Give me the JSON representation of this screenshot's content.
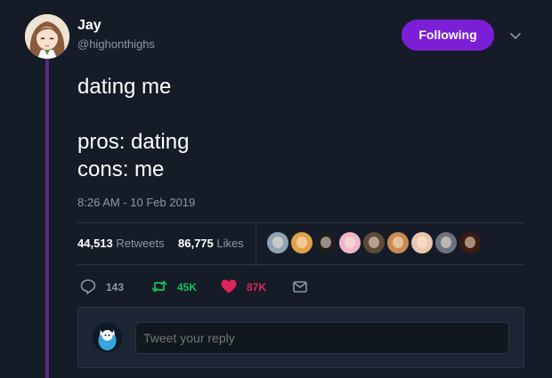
{
  "user": {
    "name": "Jay",
    "handle": "@highonthighs",
    "follow_label": "Following"
  },
  "tweet": {
    "lines": [
      "dating me",
      "",
      "pros: dating",
      "cons: me"
    ],
    "timestamp": "8:26 AM - 10 Feb 2019"
  },
  "stats": {
    "retweets_count": "44,513",
    "retweets_label": "Retweets",
    "likes_count": "86,775",
    "likes_label": "Likes"
  },
  "likers": [
    {
      "name": "liker-avatar-1",
      "color": "#8fa3b3"
    },
    {
      "name": "liker-avatar-2",
      "color": "#e0a24a"
    },
    {
      "name": "liker-avatar-3",
      "color": "#1d1d1d"
    },
    {
      "name": "liker-avatar-4",
      "color": "#f0b6c8"
    },
    {
      "name": "liker-avatar-5",
      "color": "#5b4a35"
    },
    {
      "name": "liker-avatar-6",
      "color": "#c98b52"
    },
    {
      "name": "liker-avatar-7",
      "color": "#e8c7b0"
    },
    {
      "name": "liker-avatar-8",
      "color": "#6c7380"
    },
    {
      "name": "liker-avatar-9",
      "color": "#3a1d12"
    }
  ],
  "actions": {
    "reply_count": "143",
    "retweet_count": "45K",
    "like_count": "87K"
  },
  "colors": {
    "accent": "#7a1fd6",
    "retweet": "#17bf63",
    "like": "#e0245e",
    "muted": "#8899a6"
  },
  "reply": {
    "placeholder": "Tweet your reply"
  }
}
